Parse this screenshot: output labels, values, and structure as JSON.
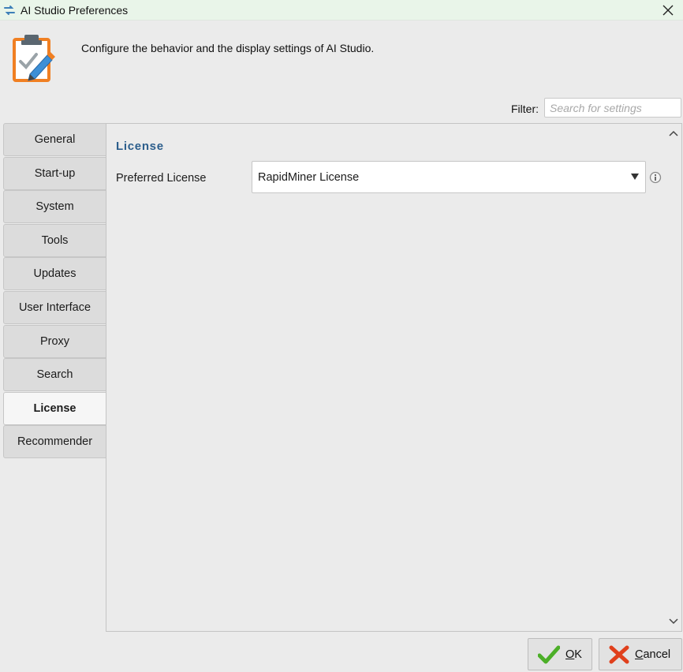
{
  "window": {
    "title": "AI Studio Preferences",
    "app_icon": "rapidminer-logo-icon",
    "close_icon": "close-icon"
  },
  "header": {
    "icon": "clipboard-edit-icon",
    "description": "Configure the behavior and the display settings of AI Studio."
  },
  "filter": {
    "label": "Filter:",
    "placeholder": "Search for settings",
    "value": ""
  },
  "tabs": [
    {
      "label": "General",
      "active": false
    },
    {
      "label": "Start-up",
      "active": false
    },
    {
      "label": "System",
      "active": false
    },
    {
      "label": "Tools",
      "active": false
    },
    {
      "label": "Updates",
      "active": false
    },
    {
      "label": "User Interface",
      "active": false
    },
    {
      "label": "Proxy",
      "active": false
    },
    {
      "label": "Search",
      "active": false
    },
    {
      "label": "License",
      "active": true
    },
    {
      "label": "Recommender",
      "active": false
    }
  ],
  "panel": {
    "section_title": "License",
    "settings": [
      {
        "label": "Preferred License",
        "value": "RapidMiner License",
        "info_icon": "info-icon"
      }
    ]
  },
  "buttons": {
    "ok_label": "OK",
    "cancel_label": "Cancel"
  },
  "colors": {
    "titlebar_bg": "#e9f5e9",
    "section_title": "#2c5e8c",
    "ok_check": "#4caf28",
    "cancel_x": "#e0401c",
    "icon_orange": "#f07f22"
  }
}
